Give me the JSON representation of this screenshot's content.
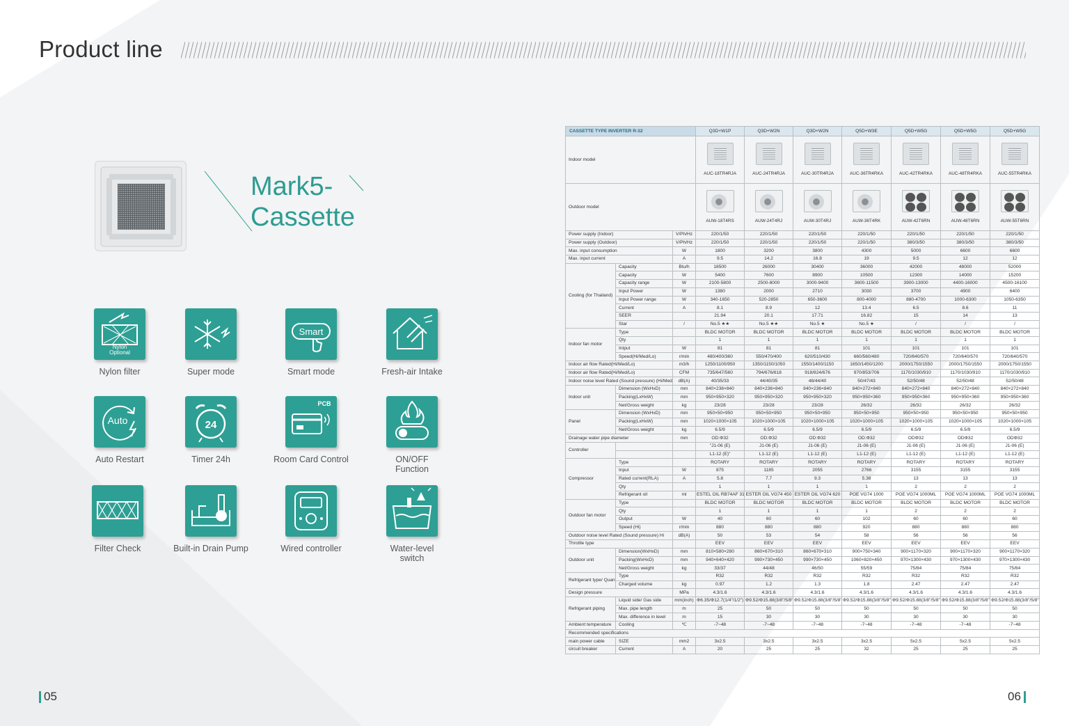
{
  "page": {
    "title": "Product line",
    "product_name_line1": "Mark5-",
    "product_name_line2": "Cassette",
    "page_left": "05",
    "page_right": "06",
    "accent_color": "#2e9f94"
  },
  "features": [
    {
      "label": "Nylon filter",
      "icon": "nylon-filter-icon",
      "icon_text": "Nylon Optional"
    },
    {
      "label": "Super mode",
      "icon": "snowflake-icon"
    },
    {
      "label": "Smart mode",
      "icon": "smart-touch-icon",
      "icon_text": "Smart"
    },
    {
      "label": "Fresh-air Intake",
      "icon": "fresh-air-house-icon"
    },
    {
      "label": "Auto Restart",
      "icon": "auto-restart-icon",
      "icon_text": "Auto"
    },
    {
      "label": "Timer 24h",
      "icon": "alarm-clock-icon",
      "icon_text": "24"
    },
    {
      "label": "Room Card Control",
      "icon": "room-card-icon",
      "icon_text": "PCB"
    },
    {
      "label": "ON/OFF Function",
      "label2": "Function",
      "label1": "ON/OFF",
      "icon": "flame-toggle-icon"
    },
    {
      "label": "Filter Check",
      "icon": "filter-check-icon"
    },
    {
      "label": "Built-in Drain Pump",
      "icon": "drain-pump-icon"
    },
    {
      "label": "Wired controller",
      "icon": "wired-controller-icon"
    },
    {
      "label1": "Water-level",
      "label2": "switch",
      "icon": "water-level-icon"
    }
  ],
  "spec": {
    "header": "CASSETTE TYPE INVERTER R-32",
    "columns": [
      "Q3D+W1P",
      "Q3D+W2N",
      "Q3D+W2N",
      "Q5D+W3E",
      "Q5D+W5G",
      "Q5D+W5G",
      "Q5D+W5G"
    ],
    "indoor_label": "Indoor model",
    "indoor_models": [
      "AUC-18TR4RJA",
      "AUC-24TR4RJA",
      "AUC-30TR4RJA",
      "AUC-36TR4RKA",
      "AUC-42TR4RKA",
      "AUC-48TR4RKA",
      "AUC-55TR4RKA"
    ],
    "outdoor_label": "Outdoor model",
    "outdoor_models": [
      "AUW-18T4RS",
      "AUW-24T4RJ",
      "AUW-30T4RJ",
      "AUW-36T4RK",
      "AUW-42T6RN",
      "AUW-48T6RN",
      "AUW-55T6RN"
    ],
    "rows": [
      {
        "g": "Power supply (Indoor)",
        "s": "",
        "u": "V/Ph/Hz",
        "v": [
          "220/1/50",
          "220/1/50",
          "220/1/50",
          "220/1/50",
          "220/1/50",
          "220/1/50",
          "220/1/50"
        ]
      },
      {
        "g": "Power supply (Outdoor)",
        "s": "",
        "u": "V/Ph/Hz",
        "v": [
          "220/1/50",
          "220/1/50",
          "220/1/50",
          "220/1/50",
          "380/3/50",
          "380/3/50",
          "380/3/50"
        ]
      },
      {
        "g": "Max. input consumption",
        "s": "",
        "u": "W",
        "v": [
          "1800",
          "3200",
          "3800",
          "4300",
          "5000",
          "6600",
          "6600"
        ]
      },
      {
        "g": "Max. input current",
        "s": "",
        "u": "A",
        "v": [
          "9.5",
          "14.2",
          "16.8",
          "19",
          "9.5",
          "12",
          "12"
        ]
      },
      {
        "g": "Cooling (for Thailand)",
        "span": 8,
        "s": "Capacity",
        "u": "Btu/h",
        "v": [
          "18500",
          "26000",
          "30400",
          "36000",
          "42000",
          "48000",
          "52000"
        ]
      },
      {
        "s": "Capacity",
        "u": "W",
        "v": [
          "5400",
          "7600",
          "8900",
          "10500",
          "12300",
          "14000",
          "15200"
        ]
      },
      {
        "s": "Capacity range",
        "u": "W",
        "v": [
          "2100-5800",
          "2500-8000",
          "3000-9400",
          "3600-11500",
          "3900-13000",
          "4400-16000",
          "4500-16100"
        ]
      },
      {
        "s": "Input Power",
        "u": "W",
        "v": [
          "1380",
          "2000",
          "2710",
          "3030",
          "3700",
          "4900",
          "6400"
        ]
      },
      {
        "s": "Input Power range",
        "u": "W",
        "v": [
          "340-1650",
          "520-2850",
          "650-3600",
          "800-4000",
          "880-4700",
          "1000-6300",
          "1050-6350"
        ]
      },
      {
        "s": "Current",
        "u": "A",
        "v": [
          "8.1",
          "8.9",
          "12",
          "13.4",
          "6.5",
          "8.6",
          "11"
        ]
      },
      {
        "s": "SEER",
        "u": "",
        "v": [
          "21.94",
          "20.1",
          "17.71",
          "16.82",
          "15",
          "14",
          "13"
        ]
      },
      {
        "s": "Star",
        "u": "/",
        "v": [
          "No.5 ★★",
          "No.5 ★★",
          "No.5 ★",
          "No.5 ★",
          "/",
          "/",
          "/"
        ]
      },
      {
        "g": "Indoor fan motor",
        "span": 4,
        "s": "Type",
        "u": "",
        "v": [
          "BLDC MOTOR",
          "BLDC MOTOR",
          "BLDC MOTOR",
          "BLDC MOTOR",
          "BLDC MOTOR",
          "BLDC MOTOR",
          "BLDC MOTOR"
        ]
      },
      {
        "s": "Qty",
        "u": "",
        "v": [
          "1",
          "1",
          "1",
          "1",
          "1",
          "1",
          "1"
        ]
      },
      {
        "s": "Intput",
        "u": "W",
        "v": [
          "81",
          "81",
          "81",
          "101",
          "101",
          "101",
          "101"
        ]
      },
      {
        "s": "Speed(Hi/Med/Lo)",
        "u": "r/min",
        "v": [
          "480/400/360",
          "550/470/400",
          "620/510/430",
          "660/560/480",
          "720/640/570",
          "720/640/570",
          "720/640/570"
        ]
      },
      {
        "g": "Indoor air flow Rated(Hi/Med/Lo)",
        "s": "",
        "u": "m3/h",
        "v": [
          "1250/1100/950",
          "1350/1150/1050",
          "1550/1400/1150",
          "1650/1450/1200",
          "2000/1750/1550",
          "2000/1750/1550",
          "2000/1750/1550"
        ]
      },
      {
        "g": "Indoor air flow Rated(Hi/Med/Lo)",
        "s": "",
        "u": "CFM",
        "v": [
          "735/647/560",
          "794/676/618",
          "918/824/676",
          "970/853/706",
          "1170/1030/910",
          "1170/1030/910",
          "1170/1030/910"
        ]
      },
      {
        "g": "Indoor noise level Rated (Sound pressure) (Hi/Med/Lo)",
        "s": "",
        "u": "dB(A)",
        "v": [
          "40/35/33",
          "44/40/35",
          "48/44/40",
          "50/47/43",
          "52/50/48",
          "52/50/48",
          "52/50/48"
        ]
      },
      {
        "g": "Indoor unit",
        "span": 3,
        "s": "Dimension (WxHxD)",
        "u": "mm",
        "v": [
          "840×236×840",
          "840×236×840",
          "840×236×840",
          "840×272×840",
          "840×272×840",
          "840×272×840",
          "840×272×840"
        ]
      },
      {
        "s": "Packing(LxHxW)",
        "u": "mm",
        "v": [
          "950×950×320",
          "950×950×320",
          "950×950×320",
          "950×950×360",
          "950×950×360",
          "950×950×360",
          "950×950×360"
        ]
      },
      {
        "s": "Net/Gross weight",
        "u": "kg",
        "v": [
          "23/28",
          "23/28",
          "23/28",
          "26/32",
          "26/32",
          "26/32",
          "26/32"
        ]
      },
      {
        "g": "Panel",
        "span": 3,
        "s": "Dimension (WxHxD)",
        "u": "mm",
        "v": [
          "950×50×950",
          "950×50×950",
          "950×50×950",
          "950×50×950",
          "950×50×950",
          "950×50×950",
          "950×50×950"
        ]
      },
      {
        "s": "Packing(LxHxW)",
        "u": "mm",
        "v": [
          "1020×1000×105",
          "1020×1000×105",
          "1020×1000×105",
          "1020×1000×105",
          "1020×1000×105",
          "1020×1000×105",
          "1020×1000×105"
        ]
      },
      {
        "s": "Net/Gross weight",
        "u": "kg",
        "v": [
          "6.5/9",
          "6.5/9",
          "6.5/9",
          "6.5/9",
          "6.5/9",
          "6.5/9",
          "6.5/9"
        ]
      },
      {
        "g": "Drainage water pipe diameter",
        "s": "",
        "u": "mm",
        "v": [
          "OD:Φ32",
          "OD:Φ32",
          "OD:Φ32",
          "OD:Φ32",
          "ODΦ32",
          "ODΦ32",
          "ODΦ32"
        ]
      },
      {
        "g": "Controller",
        "span": 2,
        "s": "",
        "u": "",
        "v": [
          "\"J1-06 (E)",
          "J1-06 (E)",
          "J1-06 (E)",
          "J1-06 (E)",
          "J1-06 (E)",
          "J1-06 (E)",
          "J1-06 (E)"
        ]
      },
      {
        "s": "",
        "u": "",
        "v": [
          "L1-12 (E)\"",
          "L1-12 (E)",
          "L1-12 (E)",
          "L1-12 (E)",
          "L1-12 (E)",
          "L1-12 (E)",
          "L1-12 (E)"
        ]
      },
      {
        "g": "Compressor",
        "span": 5,
        "s": "Type",
        "u": "",
        "v": [
          "ROTARY",
          "ROTARY",
          "ROTARY",
          "ROTARY",
          "ROTARY",
          "ROTARY",
          "ROTARY"
        ]
      },
      {
        "s": "Input",
        "u": "W",
        "v": [
          "875",
          "1185",
          "2055",
          "2766",
          "3155",
          "3155",
          "3155"
        ]
      },
      {
        "s": "Rated current(RLA)",
        "u": "A",
        "v": [
          "5.8",
          "7.7",
          "9.3",
          "5.38",
          "13",
          "13",
          "13"
        ]
      },
      {
        "s": "Qty",
        "u": "",
        "v": [
          "1",
          "1",
          "1",
          "1",
          "2",
          "2",
          "2"
        ]
      },
      {
        "s": "Refrigerant oil",
        "u": "ml",
        "v": [
          "ESTEL OIL RB74AF 310",
          "ESTER OIL VG74 450",
          "ESTER OIL VG74 620",
          "POE VG74 1000",
          "POE VG74 1000ML",
          "POE VG74 1000ML",
          "POE VG74 1000ML"
        ]
      },
      {
        "g": "Outdoor fan motor",
        "span": 4,
        "s": "Type",
        "u": "",
        "v": [
          "BLDC MOTOR",
          "BLDC MOTOR",
          "BLDC MOTOR",
          "BLDC MOTOR",
          "BLDC MOTOR",
          "BLDC MOTOR",
          "BLDC MOTOR"
        ]
      },
      {
        "s": "Qty",
        "u": "",
        "v": [
          "1",
          "1",
          "1",
          "1",
          "2",
          "2",
          "2"
        ]
      },
      {
        "s": "Output",
        "u": "W",
        "v": [
          "40",
          "60",
          "60",
          "102",
          "60",
          "60",
          "60"
        ]
      },
      {
        "s": "Speed (Hi)",
        "u": "r/min",
        "v": [
          "880",
          "880",
          "880",
          "920",
          "880",
          "880",
          "880"
        ]
      },
      {
        "g": "Outdoor noise level Rated (Sound pressure) Hi",
        "s": "",
        "u": "dB(A)",
        "v": [
          "50",
          "53",
          "54",
          "58",
          "56",
          "56",
          "56"
        ]
      },
      {
        "g": "Throttle type",
        "s": "",
        "u": "",
        "v": [
          "EEV",
          "EEV",
          "EEV",
          "EEV",
          "EEV",
          "EEV",
          "EEV"
        ]
      },
      {
        "g": "Outdoor unit",
        "span": 3,
        "s": "Dimension(WxHxD)",
        "u": "mm",
        "v": [
          "810×580×280",
          "860×670×310",
          "860×670×310",
          "900×750×340",
          "900×1170×320",
          "900×1170×320",
          "900×1170×320"
        ]
      },
      {
        "s": "Packing(WxHxD)",
        "u": "mm",
        "v": [
          "940×640×420",
          "990×730×450",
          "990×730×450",
          "1060×820×450",
          "970×1300×430",
          "970×1300×430",
          "970×1300×430"
        ]
      },
      {
        "s": "Net/Gross weight",
        "u": "kg",
        "v": [
          "33/37",
          "44/48",
          "46/50",
          "55/59",
          "75/84",
          "75/84",
          "75/84"
        ]
      },
      {
        "g": "Refrigerant type/ Quantity",
        "span": 2,
        "s": "Type",
        "u": "",
        "v": [
          "R32",
          "R32",
          "R32",
          "R32",
          "R32",
          "R32",
          "R32"
        ]
      },
      {
        "s": "Charged volume",
        "u": "kg",
        "v": [
          "0.97",
          "1.2",
          "1.3",
          "1.8",
          "2.47",
          "2.47",
          "2.47"
        ]
      },
      {
        "g": "Design pressure",
        "s": "",
        "u": "MPa",
        "v": [
          "4.3/1.6",
          "4.3/1.6",
          "4.3/1.6",
          "4.3/1.6",
          "4.3/1.6",
          "4.3/1.6",
          "4.3/1.6"
        ]
      },
      {
        "g": "Refrigerant piping",
        "span": 3,
        "s": "Liquid side/ Gas side",
        "u": "mm(inch)",
        "v": [
          "Φ6.35/Φ12.7(1/4\"/1/2\")",
          "Φ9.52/Φ15.88(3/8\"/5/8\")",
          "Φ9.52/Φ15.88(3/8\"/5/8\")",
          "Φ9.52/Φ15.88(3/8\"/5/8\")",
          "Φ9.52/Φ15.88(3/8\"/5/8\")",
          "Φ9.52/Φ15.88(3/8\"/5/8\")",
          "Φ9.52/Φ15.88(3/8\"/5/8\")"
        ]
      },
      {
        "s": "Max. pipe length",
        "u": "m",
        "v": [
          "25",
          "50",
          "50",
          "50",
          "50",
          "50",
          "50"
        ]
      },
      {
        "s": "Max. difference in level",
        "u": "m",
        "v": [
          "15",
          "30",
          "30",
          "30",
          "30",
          "30",
          "30"
        ]
      },
      {
        "g": "Ambient temperature",
        "s": "Cooling",
        "u": "℃",
        "v": [
          "-7~48",
          "-7~48",
          "-7~48",
          "-7~48",
          "-7~48",
          "-7~48",
          "-7~48"
        ]
      },
      {
        "g": "Recommended specifications",
        "full": true
      },
      {
        "g": "main power cable",
        "s": "SIZE",
        "u": "mm2",
        "v": [
          "3x2.5",
          "3x2.5",
          "3x2.5",
          "3x2.5",
          "5x2.5",
          "5x2.5",
          "5x2.5"
        ]
      },
      {
        "g": "circuit breaker",
        "s": "Current",
        "u": "A",
        "v": [
          "20",
          "25",
          "25",
          "32",
          "25",
          "25",
          "25"
        ]
      }
    ]
  }
}
